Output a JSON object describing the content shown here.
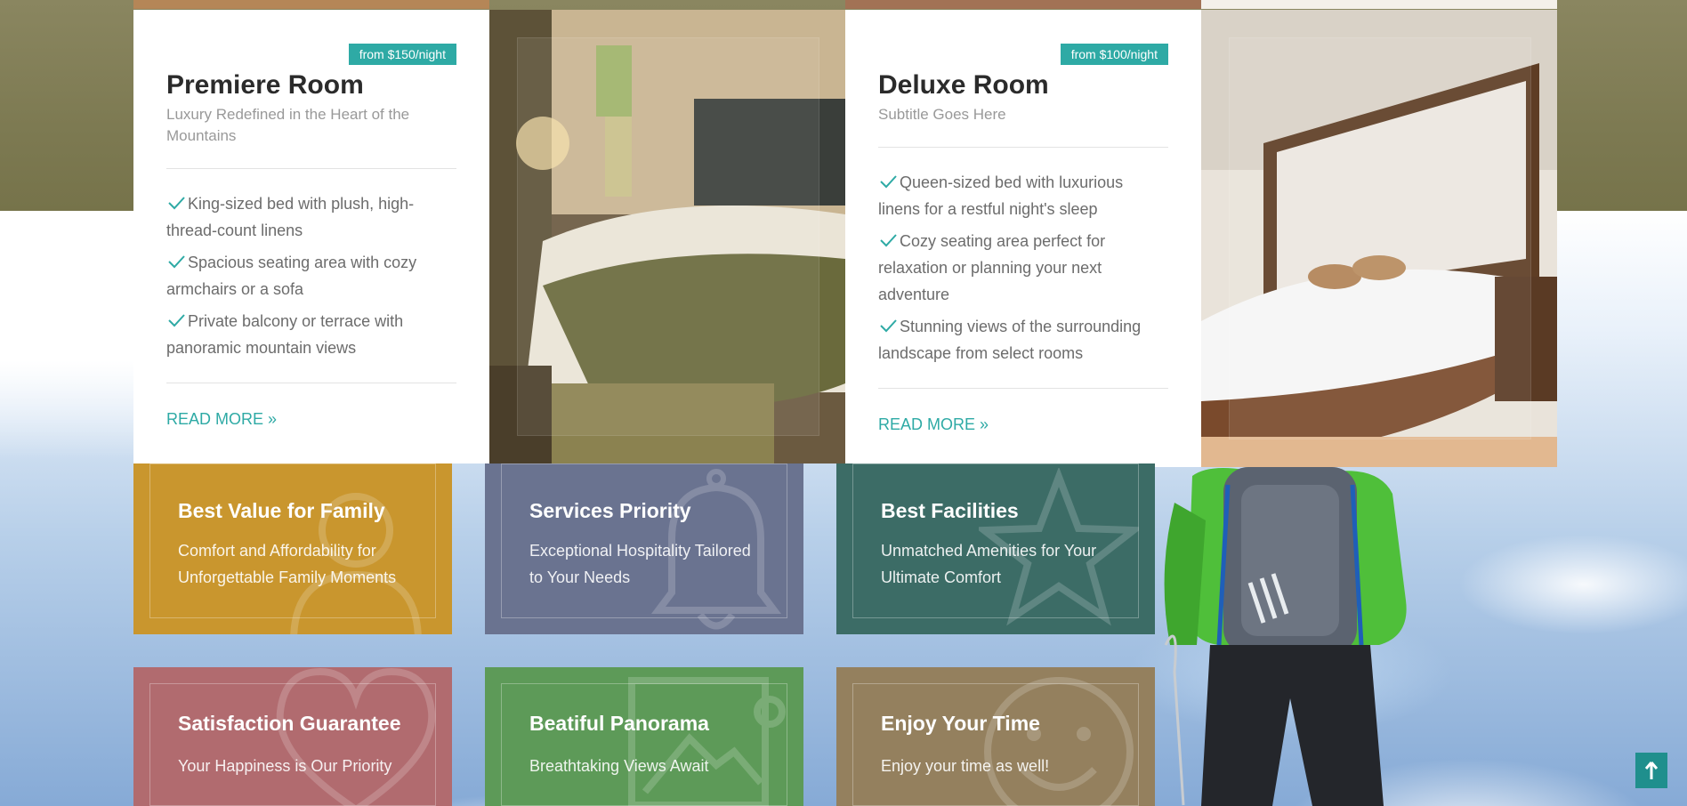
{
  "colors": {
    "accent": "#2eaaa5",
    "tile_family": "#c9962e",
    "tile_services": "#6a7390",
    "tile_facilities": "#3c6c66",
    "tile_satisfaction": "#b16b6f",
    "tile_panorama": "#5d9a58",
    "tile_enjoy": "#94805e"
  },
  "rooms": [
    {
      "price": "from $150/night",
      "title": "Premiere Room",
      "subtitle": "Luxury Redefined in the Heart of the Mountains",
      "features": [
        "King-sized bed with plush, high-thread-count linens",
        "Spacious seating area with cozy armchairs or a sofa",
        "Private balcony or terrace with panoramic mountain views"
      ],
      "read_more": "READ MORE »"
    },
    {
      "price": "from $100/night",
      "title": "Deluxe Room",
      "subtitle": "Subtitle Goes Here",
      "features": [
        "Queen-sized bed with luxurious linens for a restful night's sleep",
        "Cozy seating area perfect for relaxation or planning your next adventure",
        "Stunning views of the surrounding landscape from select rooms"
      ],
      "read_more": "READ MORE »"
    }
  ],
  "tiles": [
    {
      "title": "Best Value for Family",
      "text": "Comfort and Affordability for Unforgettable Family Moments",
      "icon": "user-icon"
    },
    {
      "title": "Services Priority",
      "text": "Exceptional Hospitality Tailored to Your Needs",
      "icon": "bell-icon"
    },
    {
      "title": "Best Facilities",
      "text": "Unmatched Amenities for Your Ultimate Comfort",
      "icon": "star-icon"
    },
    {
      "title": "Satisfaction Guarantee",
      "text": "Your Happiness is Our Priority",
      "icon": "heart-icon"
    },
    {
      "title": "Beatiful Panorama",
      "text": "Breathtaking Views Await",
      "icon": "picture-icon"
    },
    {
      "title": "Enjoy Your Time",
      "text": "Enjoy your time as well!",
      "icon": "smile-icon"
    }
  ],
  "scroll_top": {
    "icon": "arrow-up-icon"
  }
}
